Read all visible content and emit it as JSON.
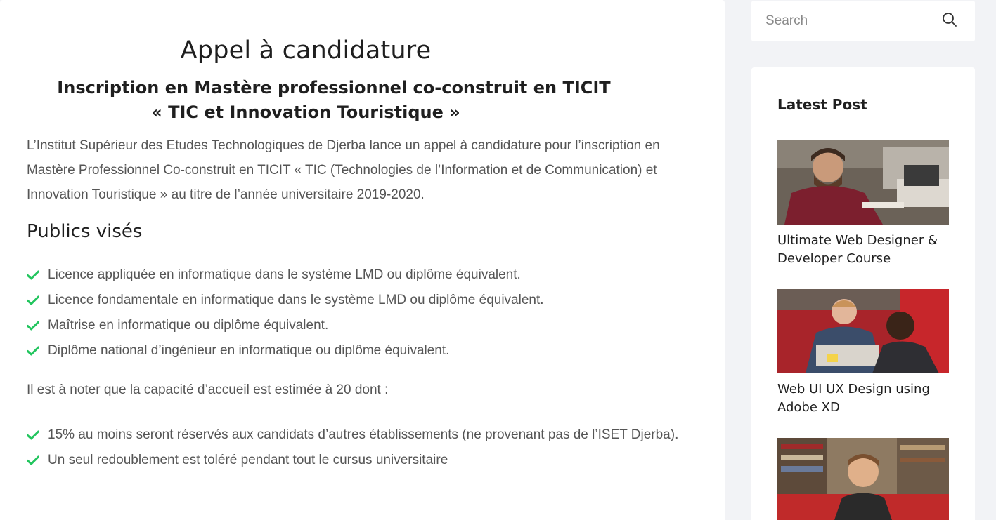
{
  "article": {
    "title": "Appel à candidature",
    "subtitle_line1": "Inscription en Mastère professionnel co-construit en TICIT",
    "subtitle_line2": "« TIC et Innovation Touristique »",
    "intro": "L’Institut Supérieur des Etudes Technologiques de Djerba lance un appel à candidature pour l’inscription en Mastère Professionnel Co-construit en TICIT « TIC (Technologies de l’Information et de Communication) et Innovation Touristique » au titre de l’année universitaire 2019-2020.",
    "section_publics": "Publics visés",
    "publics": [
      "Licence appliquée en informatique dans le système LMD ou diplôme équivalent.",
      "Licence fondamentale en informatique dans le système LMD ou diplôme équivalent.",
      "Maîtrise en informatique ou diplôme équivalent.",
      "Diplôme national d’ingénieur en informatique ou diplôme équivalent."
    ],
    "capacity_note": "Il est à noter que la capacité d’accueil est estimée à 20 dont :",
    "conditions": [
      "15% au moins seront réservés aux candidats d’autres établissements (ne provenant pas de l’ISET Djerba).",
      "Un seul redoublement est toléré pendant tout le cursus universitaire"
    ]
  },
  "sidebar": {
    "search": {
      "placeholder": "Search"
    },
    "latest_title": "Latest Post",
    "posts": [
      {
        "title": "Ultimate Web Designer & Developer Course"
      },
      {
        "title": "Web UI UX Design using Adobe XD"
      },
      {
        "title": ""
      }
    ]
  },
  "colors": {
    "page_bg": "#f2f3f6",
    "card_bg": "#ffffff",
    "check": "#22c55e",
    "heading": "#1f1f1f",
    "body_text": "#555555"
  }
}
